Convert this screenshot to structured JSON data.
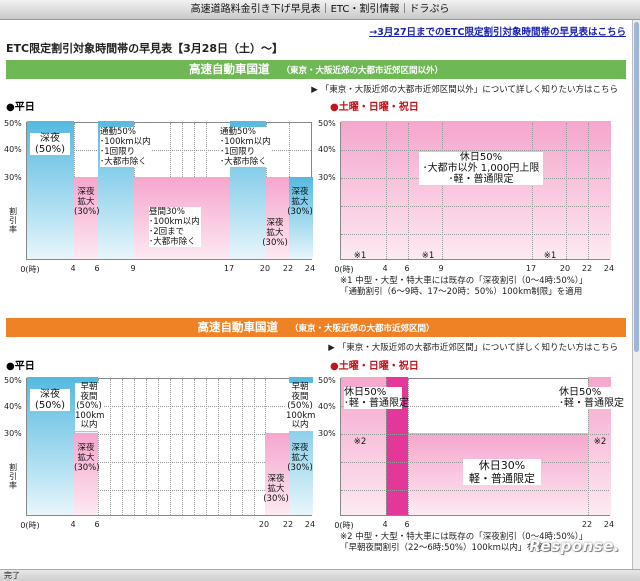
{
  "window": {
    "title": "高速道路料金引き下げ早見表｜ETC・割引情報｜ドラぷら",
    "status": "完了"
  },
  "top_link": "→3月27日までのETC限定割引対象時間帯の早見表はこちら",
  "page_title": "ETC限定割引対象時間帯の早見表【3月28日（土）〜】",
  "sections": [
    {
      "band_title": "高速自動車国道",
      "band_sub": "（東京・大阪近郊の大都市近郊区間以外）",
      "note": "「東京・大阪近郊の大都市近郊区間以外」について詳しく知りたい方はこちら",
      "weekday_title": "●平日",
      "weekend_title": "●土曜・日曜・祝日",
      "y_ticks": [
        "50%",
        "40%",
        "30%"
      ],
      "y_axis_label": "割引率",
      "weekday_x": [
        "0(時)",
        "4",
        "6",
        "9",
        "17",
        "20",
        "22",
        "24"
      ],
      "weekend_x": [
        "0(時)",
        "4",
        "6",
        "9",
        "17",
        "20",
        "22",
        "24"
      ],
      "weekday_labels": {
        "night": "深夜\n(50%)",
        "commute1": "通勤50%\n･100km以内\n･1回限り\n･大都市除く",
        "expand1": "深夜\n拡大\n(30%)",
        "day": "昼間30%\n･100km以内\n･2回まで\n･大都市除く",
        "commute2": "通勤50%\n･100km以内\n･1回限り\n･大都市除く",
        "expand2": "深夜\n拡大\n(30%)",
        "expand3": "深夜\n拡大\n(30%)"
      },
      "weekend_labels": {
        "holiday": "休日50%\n･大都市以外 1,000円上限\n･軽・普通限定",
        "n1": "※1",
        "n2": "※1",
        "n3": "※1"
      },
      "footnote": "※1 中型・大型・特大車には既存の「深夜割引（0〜4時:50%）」\n「通勤割引（6〜9時、17〜20時：50%）100km制限」を適用"
    },
    {
      "band_title": "高速自動車国道",
      "band_sub": "（東京・大阪近郊の大都市近郊区間）",
      "note": "「東京・大阪近郊の大都市近郊区間」について詳しく知りたい方はこちら",
      "weekday_title": "●平日",
      "weekend_title": "●土曜・日曜・祝日",
      "y_ticks": [
        "50%",
        "40%",
        "30%"
      ],
      "y_axis_label": "割引率",
      "weekday_x": [
        "0(時)",
        "4",
        "6",
        "20",
        "22",
        "24"
      ],
      "weekend_x": [
        "0(時)",
        "4",
        "6",
        "22",
        "24"
      ],
      "weekday_labels": {
        "night": "深夜\n(50%)",
        "early": "早朝\n夜間\n(50%)\n100km\n以内",
        "expand1": "深夜\n拡大\n(30%)",
        "latenight": "早朝\n夜間\n(50%)\n100km\n以内",
        "expand2": "深夜\n拡大\n(30%)",
        "expand3": "深夜\n拡大\n(30%)"
      },
      "weekend_labels": {
        "h1": "休日50%\n･軽・普通限定",
        "h2": "休日50%\n･軽・普通限定",
        "mid": "休日30%\n軽・普通限定",
        "n1": "※2",
        "n2": "※2"
      },
      "footnote": "※2 中型・大型・特大車には既存の「深夜割引（0〜4時:50%）」\n「早朝夜間割引（22〜6時:50%）100km以内」を適用"
    }
  ],
  "watermark": "Response.",
  "colors": {
    "green": "#6fb856",
    "orange": "#f08226",
    "weekday": "#55b9e0",
    "weekend": "#f5a6cc",
    "accent": "#e3389a"
  }
}
